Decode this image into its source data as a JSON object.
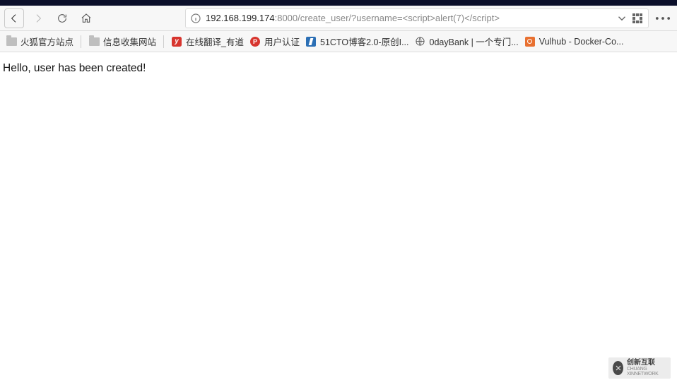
{
  "url": {
    "host": "192.168.199.174",
    "rest": ":8000/create_user/?username=<script>alert(7)</script>"
  },
  "bookmarks": {
    "b1": "火狐官方站点",
    "b2": "信息收集网站",
    "b3": "在线翻译_有道",
    "b4": "用户认证",
    "b5": "51CTO博客2.0-原创I...",
    "b6": "0dayBank | 一个专门...",
    "b7": "Vulhub - Docker-Co..."
  },
  "page": {
    "message": "Hello, user has been created!"
  },
  "watermark": {
    "line1": "创新互联",
    "line2": "CHUANG XINNETWORK"
  }
}
